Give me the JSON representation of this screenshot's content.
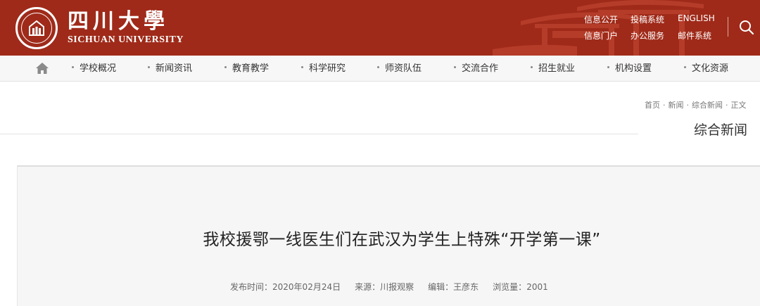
{
  "header": {
    "logo_cn": "四川大學",
    "logo_en": "SICHUAN UNIVERSITY",
    "top_links": [
      "信息公开",
      "投稿系统",
      "ENGLISH",
      "信息门户",
      "办公服务",
      "邮件系统"
    ],
    "brand_color": "#9f2a19"
  },
  "nav": {
    "home_icon": "home-icon",
    "items": [
      "学校概况",
      "新闻资讯",
      "教育教学",
      "科学研究",
      "师资队伍",
      "交流合作",
      "招生就业",
      "机构设置",
      "文化资源"
    ]
  },
  "breadcrumb": [
    "首页",
    "新闻",
    "综合新闻",
    "正文"
  ],
  "section_title": "综合新闻",
  "article": {
    "title": "我校援鄂一线医生们在武汉为学生上特殊“开学第一课”",
    "publish_label": "发布时间：",
    "publish_date": "2020年02月24日",
    "source_label": "来源：",
    "source": "川报观察",
    "editor_label": "编辑：",
    "editor": "王彦东",
    "views_label": "浏览量：",
    "views": "2001"
  }
}
